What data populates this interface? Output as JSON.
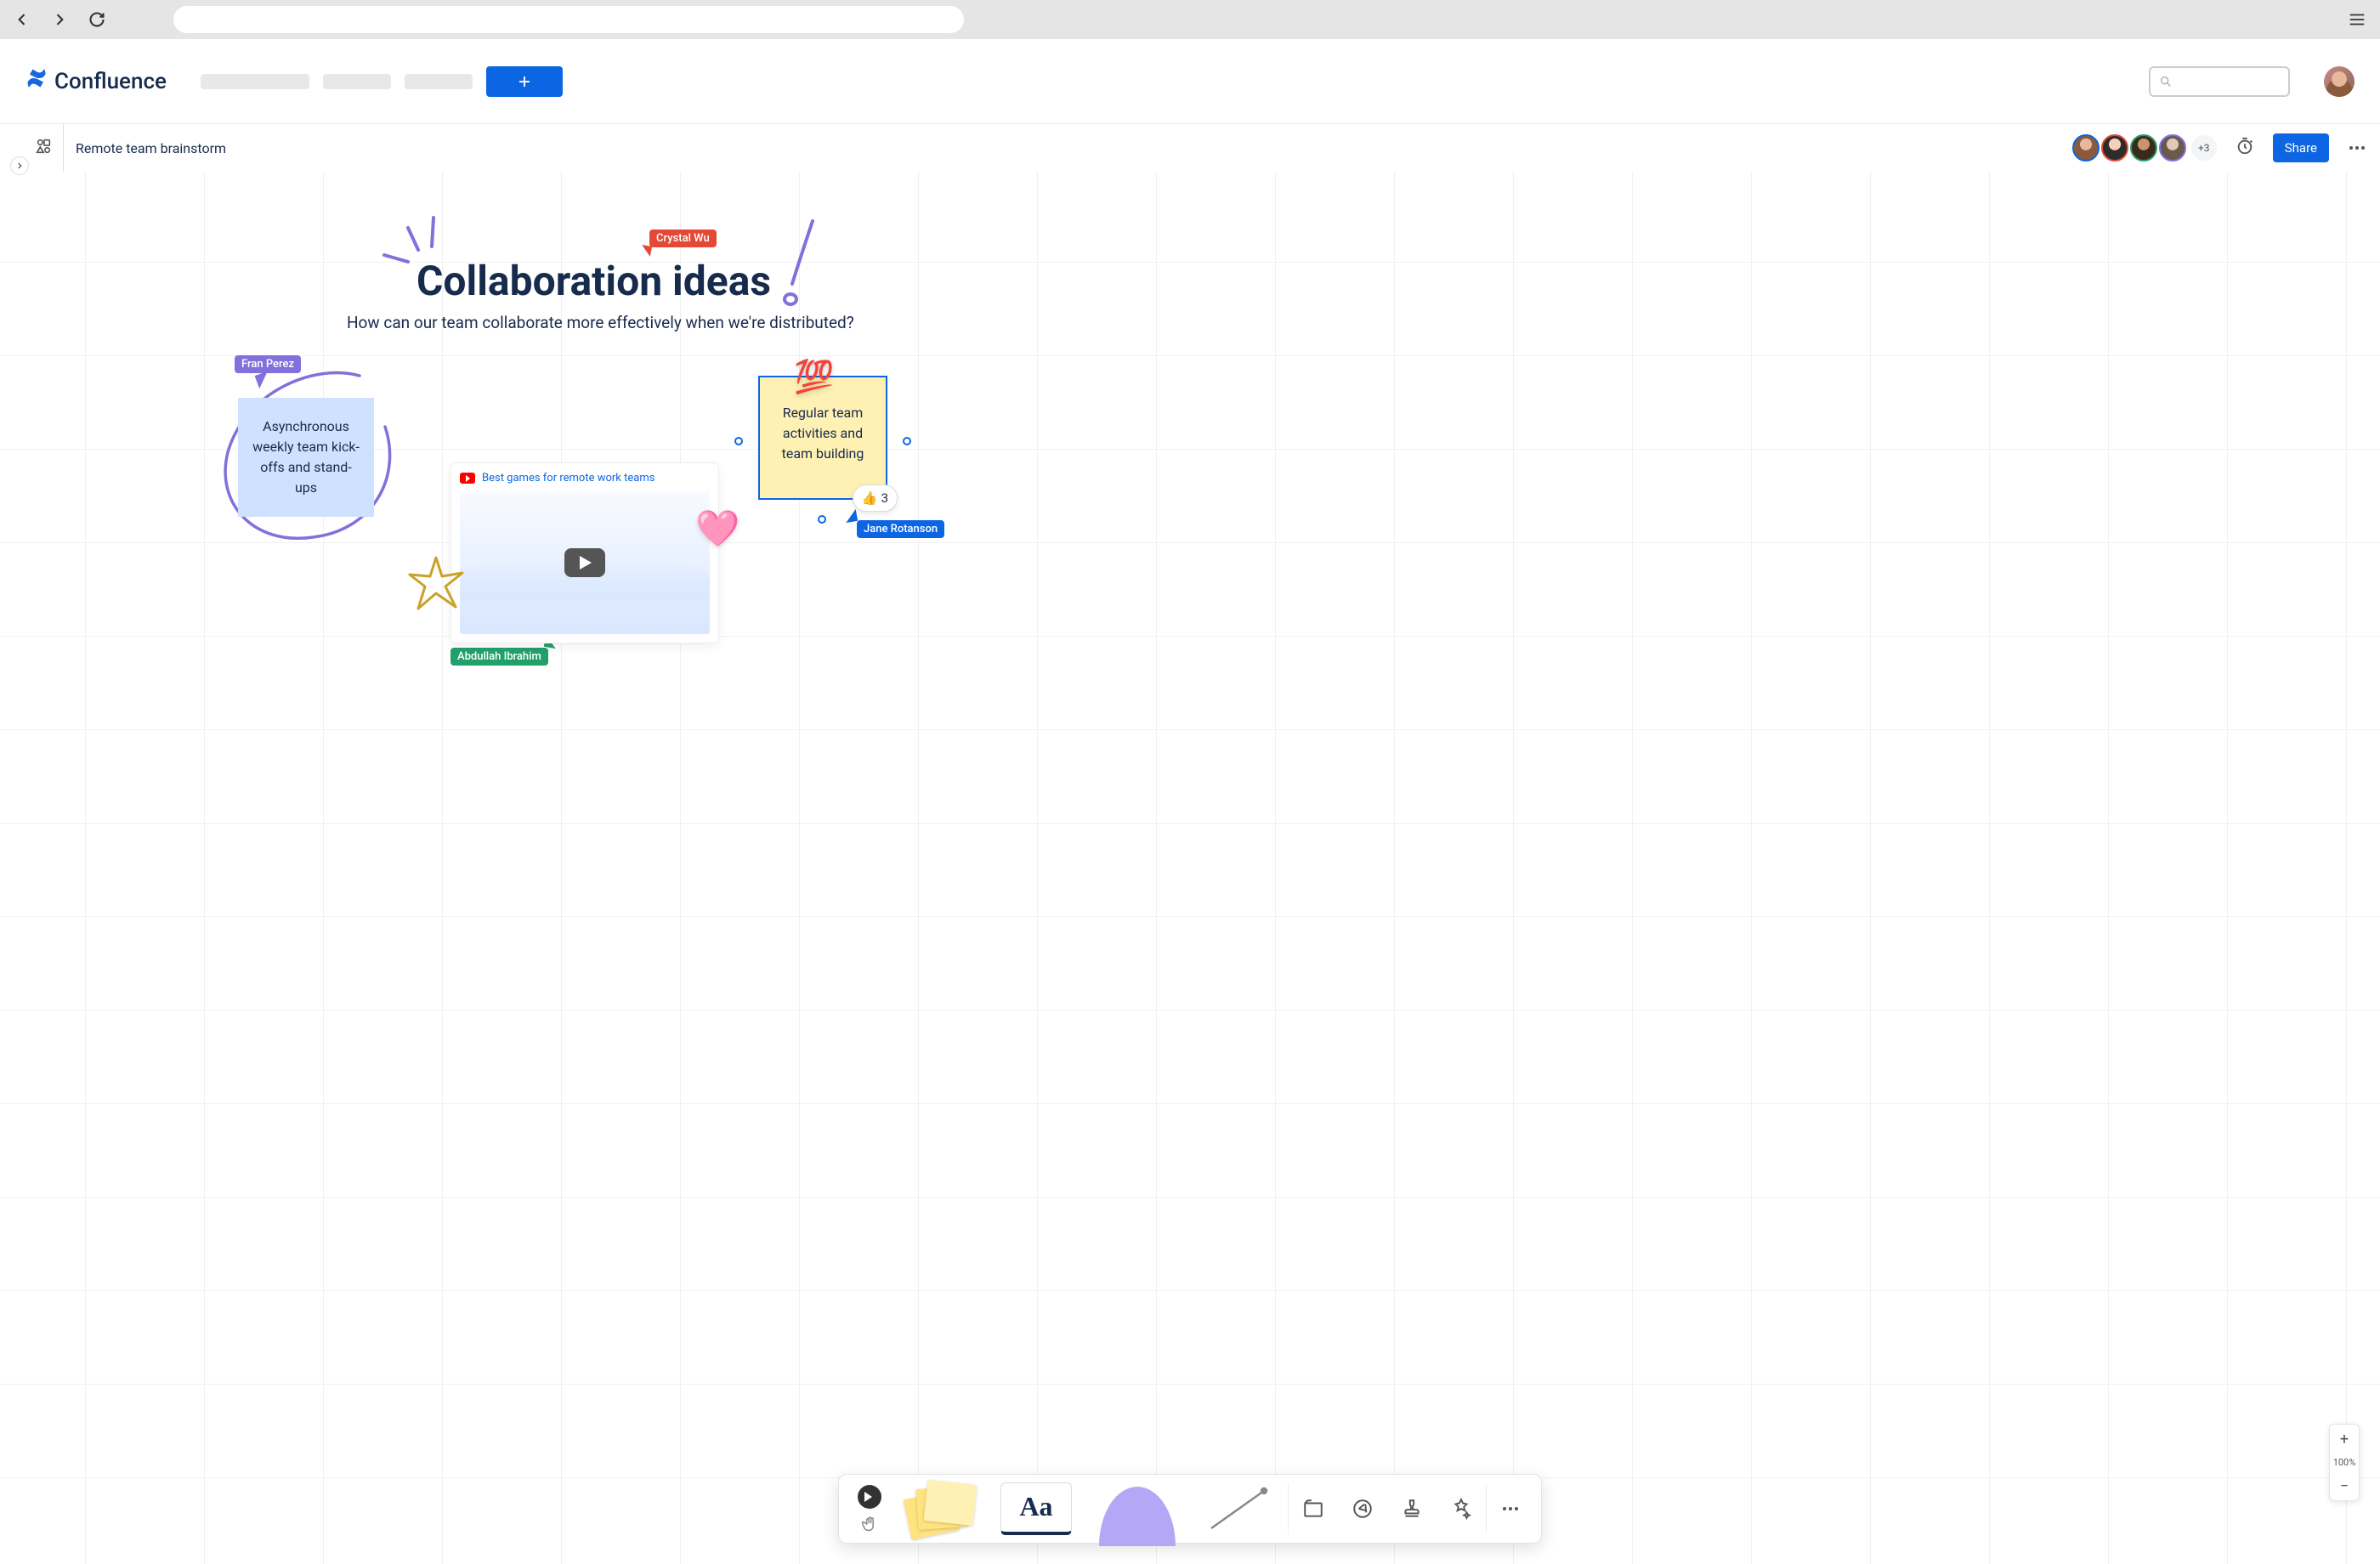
{
  "app": {
    "name": "Confluence"
  },
  "header": {
    "create_label": "+",
    "page_title": "Remote team brainstorm",
    "share": "Share",
    "more_presence": "+3"
  },
  "whiteboard": {
    "title": "Collaboration ideas",
    "subtitle": "How can our team collaborate more effectively when we're distributed?"
  },
  "cursors": {
    "crystal": "Crystal Wu",
    "fran": "Fran Perez",
    "abdullah": "Abdullah Ibrahim",
    "jane": "Jane Rotanson"
  },
  "stickies": {
    "blue": "Asynchronous weekly team kick-offs and stand-ups",
    "yellow": "Regular team activities and team building"
  },
  "reactions": {
    "thumbs_count": "3"
  },
  "video": {
    "title": "Best games for remote work teams"
  },
  "zoom": {
    "level": "100%"
  },
  "toolbar": {
    "text_label": "Aa"
  }
}
